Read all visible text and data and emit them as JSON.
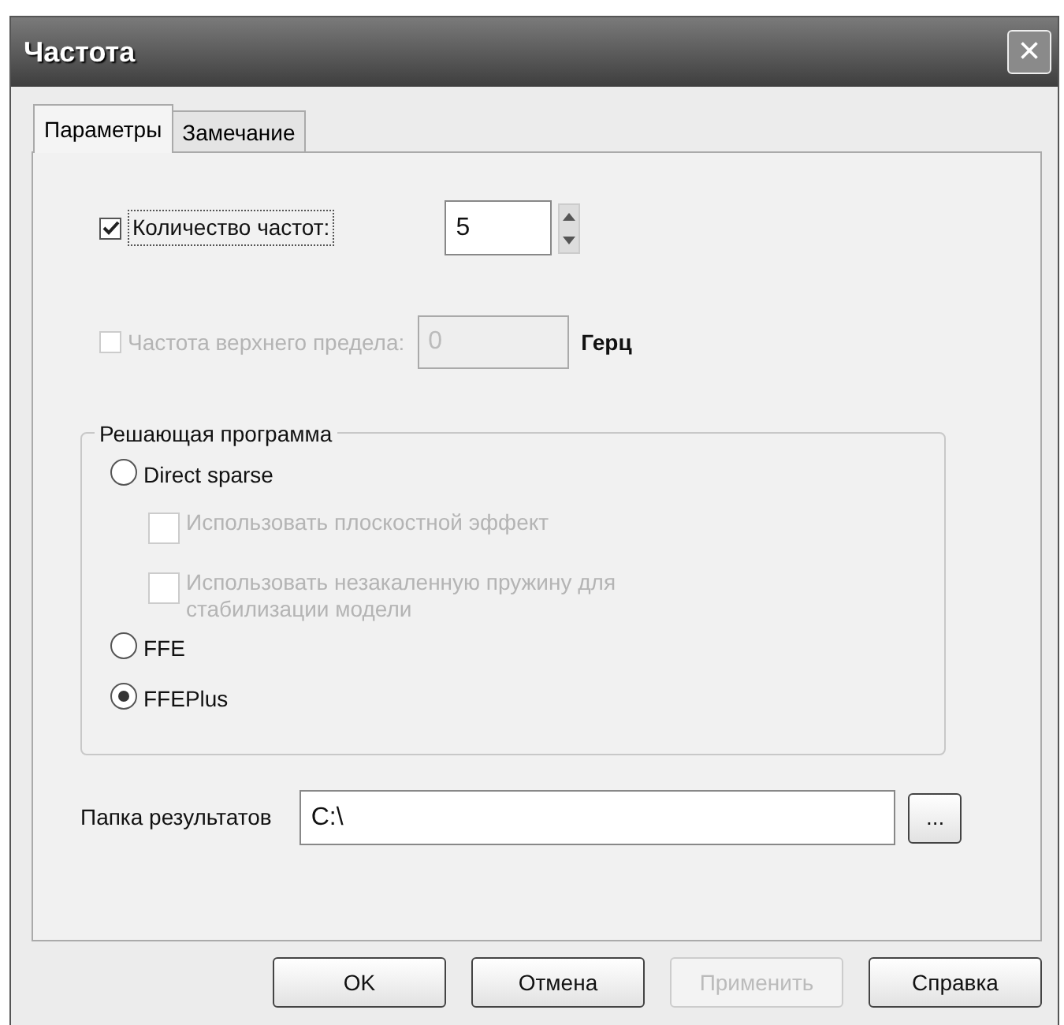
{
  "window": {
    "title": "Частота",
    "close": "×"
  },
  "tabs": [
    {
      "label": "Параметры",
      "selected": true
    },
    {
      "label": "Замечание",
      "selected": false
    }
  ],
  "frequency_count": {
    "label": "Количество частот:",
    "checked": true,
    "disabled": false,
    "value": "5"
  },
  "upper_limit": {
    "label": "Частота верхнего предела:",
    "checked": false,
    "disabled": true,
    "value": "0",
    "unit": "Герц"
  },
  "solver": {
    "title": "Решающая программа",
    "options": [
      {
        "kind": "radio",
        "label": "Direct sparse",
        "selected": false
      },
      {
        "kind": "check",
        "label": "Использовать плоскостной эффект",
        "checked": false,
        "disabled": true
      },
      {
        "kind": "check",
        "label": "Использовать незакаленную пружину для стабилизации модели",
        "checked": false,
        "disabled": true
      },
      {
        "kind": "radio",
        "label": "FFE",
        "selected": false
      },
      {
        "kind": "radio",
        "label": "FFEPlus",
        "selected": true
      }
    ]
  },
  "results_folder": {
    "label": "Папка результатов",
    "value": "C:\\",
    "browse": "..."
  },
  "buttons": [
    {
      "label": "OK",
      "disabled": false
    },
    {
      "label": "Отмена",
      "disabled": false
    },
    {
      "label": "Применить",
      "disabled": true
    },
    {
      "label": "Справка",
      "disabled": false
    }
  ]
}
